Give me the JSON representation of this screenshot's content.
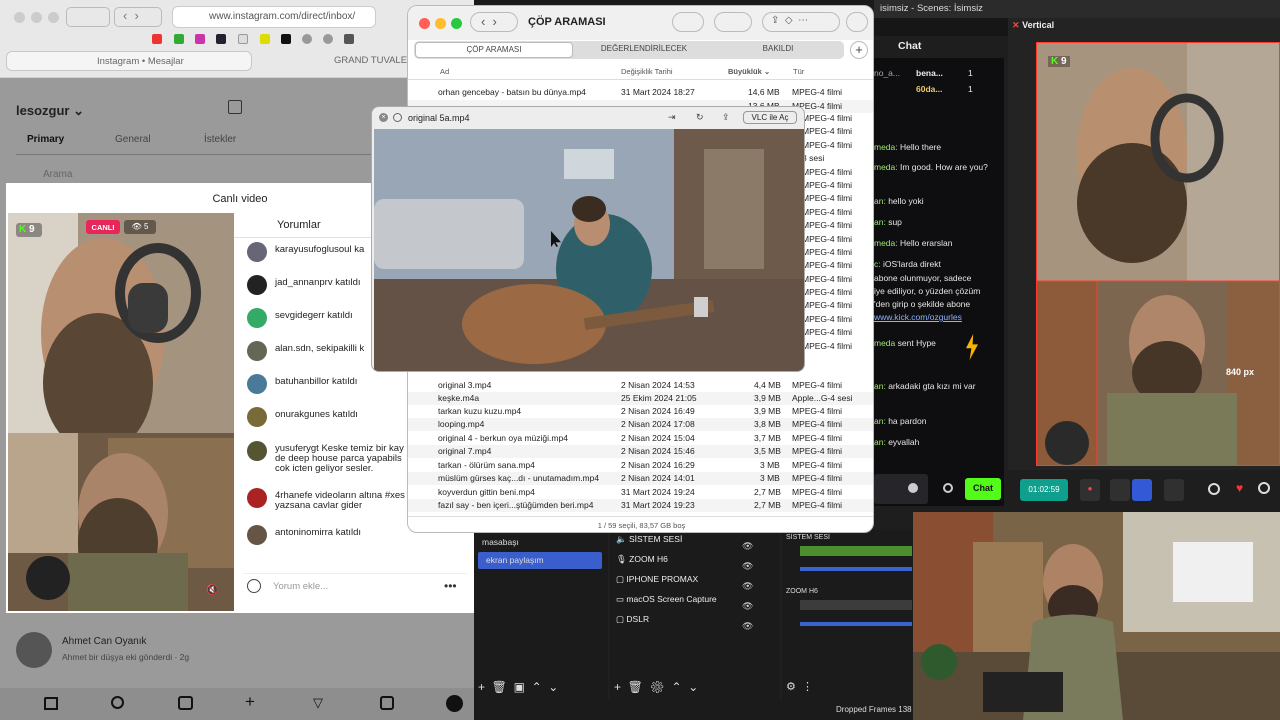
{
  "browser": {
    "url": "www.instagram.com/direct/inbox/",
    "tabs": [
      {
        "label": "Instagram • Mesajlar"
      },
      {
        "label": "GRAND TUVALET"
      }
    ]
  },
  "instagram": {
    "username": "lesozgur",
    "tabs": [
      "Primary",
      "General",
      "İstekler"
    ],
    "search_placeholder": "Arama",
    "live": {
      "title": "Canlı video",
      "badge": "CANLI",
      "viewers": "5",
      "kick_count": "9",
      "comments_header": "Yorumlar",
      "comments": [
        {
          "user": "karayusufoglusoul ka"
        },
        {
          "user": "jad_annanprv katıldı"
        },
        {
          "user": "sevgidegerr katıldı"
        },
        {
          "user": "alan.sdn, sekipakilli k"
        },
        {
          "user": "batuhanbillor katıldı"
        },
        {
          "user": "onurakgunes katıldı"
        },
        {
          "user": "yusuferygt Keske temiz bir kay",
          "line2": "de deep house parca yapabils",
          "line3": "cok icten geliyor sesler."
        },
        {
          "user": "4rhanefe videoların altına #xes",
          "line2": "yazsana cavlar gider"
        },
        {
          "user": "antoninomirra katıldı"
        }
      ],
      "comment_placeholder": "Yorum ekle..."
    },
    "dm": {
      "name": "Ahmet Can Oyanık",
      "preview": "Ahmet bir düşya eki gönderdi",
      "time": "2g"
    }
  },
  "finder": {
    "title": "ÇÖP ARAMASI",
    "scope_tabs": [
      "ÇÖP ARAMASI",
      "DEĞERLENDİRİLECEK",
      "BAKILDI"
    ],
    "columns": [
      "Ad",
      "Değişiklik Tarihi",
      "Büyüklük",
      "Tür"
    ],
    "rows_top": [
      {
        "name": "orhan gencebay - batsın bu dünya.mp4",
        "date": "31 Mart 2024 18:27",
        "size": "14,6 MB",
        "kind": "MPEG-4 filmi"
      },
      {
        "name": "",
        "date": "",
        "size": "13,6 MB",
        "kind": "MPEG-4 filmi"
      }
    ],
    "rows_bottom": [
      {
        "name": "original 3.mp4",
        "date": "2 Nisan 2024 14:53",
        "size": "4,4 MB",
        "kind": "MPEG-4 filmi"
      },
      {
        "name": "keşke.m4a",
        "date": "25 Ekim 2024 21:05",
        "size": "3,9 MB",
        "kind": "Apple...G-4 sesi"
      },
      {
        "name": "tarkan kuzu kuzu.mp4",
        "date": "2 Nisan 2024 16:49",
        "size": "3,9 MB",
        "kind": "MPEG-4 filmi"
      },
      {
        "name": "looping.mp4",
        "date": "2 Nisan 2024 17:08",
        "size": "3,8 MB",
        "kind": "MPEG-4 filmi"
      },
      {
        "name": "original 4 - berkun oya müziği.mp4",
        "date": "2 Nisan 2024 15:04",
        "size": "3,7 MB",
        "kind": "MPEG-4 filmi"
      },
      {
        "name": "original 7.mp4",
        "date": "2 Nisan 2024 15:46",
        "size": "3,5 MB",
        "kind": "MPEG-4 filmi"
      },
      {
        "name": "tarkan - ölürüm sana.mp4",
        "date": "2 Nisan 2024 16:29",
        "size": "3 MB",
        "kind": "MPEG-4 filmi"
      },
      {
        "name": "müslüm gürses kaç...dı - unutamadım.mp4",
        "date": "2 Nisan 2024 14:01",
        "size": "3 MB",
        "kind": "MPEG-4 filmi"
      },
      {
        "name": "koyverdun gittin beni.mp4",
        "date": "31 Mart 2024 19:24",
        "size": "2,7 MB",
        "kind": "MPEG-4 filmi"
      },
      {
        "name": "fazıl say - ben içeri...ştüğümden beri.mp4",
        "date": "31 Mart 2024 19:23",
        "size": "2,7 MB",
        "kind": "MPEG-4 filmi"
      }
    ],
    "side_kinds": [
      "MPEG-4 filmi",
      "MPEG-4 filmi",
      "MPEG-4 filmi",
      "3 sesi",
      "MPEG-4 filmi",
      "MPEG-4 filmi",
      "MPEG-4 filmi",
      "MPEG-4 filmi",
      "MPEG-4 filmi",
      "MPEG-4 filmi",
      "MPEG-4 filmi",
      "MPEG-4 filmi",
      "MPEG-4 filmi",
      "MPEG-4 filmi",
      "MPEG-4 filmi",
      "MPEG-4 filmi",
      "MPEG-4 filmi",
      "MPEG-4 filmi"
    ],
    "status": "1 / 59 seçili, 83,57 GB boş"
  },
  "player": {
    "title": "original 5a.mp4",
    "open_with": "VLC ile Aç"
  },
  "obs": {
    "title": "isimsiz - Scenes: İsimsiz",
    "chat_title": "Chat",
    "chat_stats": [
      {
        "name": "no_a...",
        "label": "bena...",
        "count": "1"
      },
      {
        "name": "",
        "label": "60da...",
        "count": "1"
      }
    ],
    "chat_lines": [
      {
        "user": "meda:",
        "msg": "Hello there"
      },
      {
        "user": "meda:",
        "msg": "Im good. How are you?"
      },
      {
        "user": "an:",
        "msg": "hello yoki"
      },
      {
        "user": "an:",
        "msg": "sup"
      },
      {
        "user": "meda:",
        "msg": "Hello erarslan"
      },
      {
        "user": "c:",
        "msg": "iOS'larda direkt"
      },
      {
        "user": "",
        "msg": "abone olunmuyor, sadece"
      },
      {
        "user": "",
        "msg": "iye ediliyor, o yüzden çözüm"
      },
      {
        "user": "",
        "msg": "'den girip o şekilde abone"
      },
      {
        "user": "",
        "msg": "www.kick.com/ozgurles"
      },
      {
        "user": "meda",
        "msg": "sent Hype"
      },
      {
        "user": "an:",
        "msg": "arkadaki gta kızı mi var"
      },
      {
        "user": "an:",
        "msg": "ha pardon"
      },
      {
        "user": "an:",
        "msg": "eyvallah"
      }
    ],
    "chat_button": "Chat",
    "vertical_title": "Vertical",
    "vertical_kick_count": "9",
    "measure": "840 px",
    "timer": "01:02:59",
    "scenes": [
      "masabaşı",
      "ekran paylaşım"
    ],
    "sources": [
      "SİSTEM SESİ",
      "ZOOM H6",
      "IPHONE PROMAX",
      "macOS Screen Capture",
      "DSLR"
    ],
    "mixer": [
      "SİSTEM SESİ",
      "ZOOM H6"
    ],
    "dropped": "Dropped Frames 138"
  }
}
